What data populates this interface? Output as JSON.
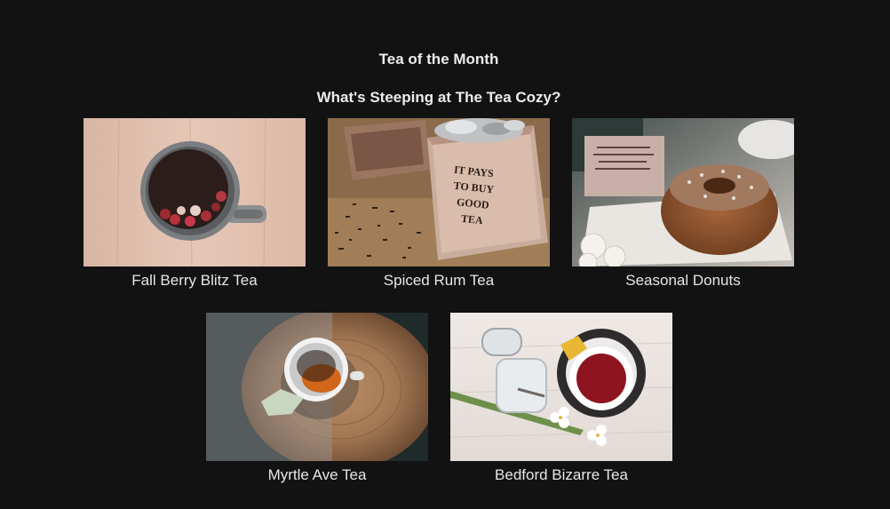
{
  "section": {
    "title": "Tea of the Month",
    "subtitle": "What's Steeping at The Tea Cozy?"
  },
  "items": [
    {
      "caption": "Fall Berry Blitz Tea",
      "image": "mug-of-berry-tea-photo"
    },
    {
      "caption": "Spiced Rum Tea",
      "image": "tea-crate-photo",
      "crate_text": [
        "IT PAYS",
        "TO BUY",
        "GOOD",
        "TEA"
      ]
    },
    {
      "caption": "Seasonal Donuts",
      "image": "sugared-donut-photo"
    },
    {
      "caption": "Myrtle Ave Tea",
      "image": "teacup-on-wood-slice-photo"
    },
    {
      "caption": "Bedford Bizarre Tea",
      "image": "red-tea-cup-with-jar-photo"
    }
  ],
  "colors": {
    "background": "#121212",
    "text": "#e8e8e8"
  }
}
